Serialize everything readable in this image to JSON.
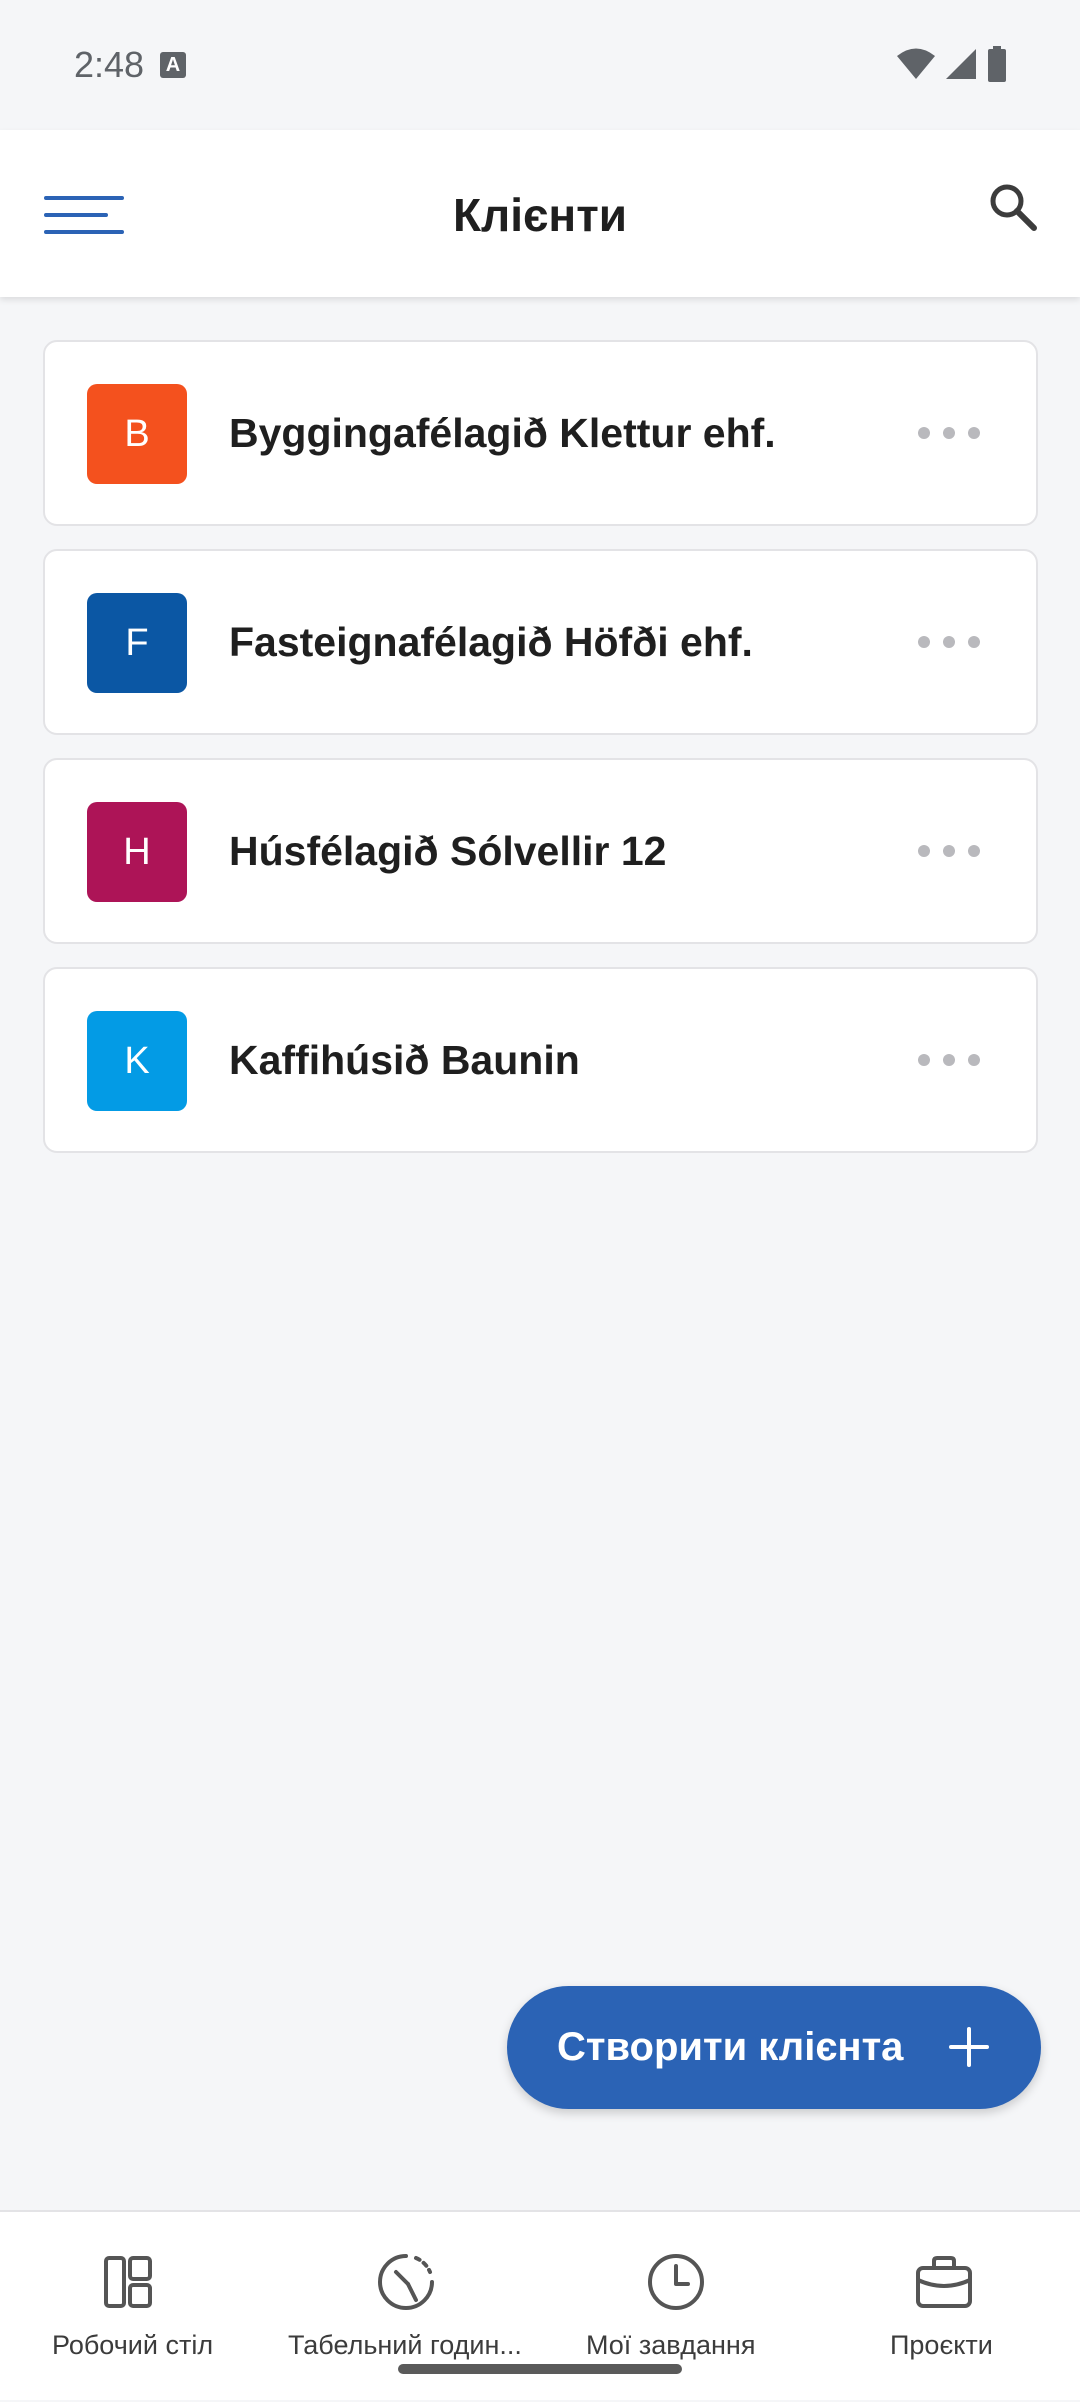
{
  "status_bar": {
    "time": "2:48",
    "notification_icon": "A"
  },
  "app_bar": {
    "title": "Клієнти",
    "menu_icon": "hamburger-menu-icon",
    "search_icon": "search-icon"
  },
  "clients": [
    {
      "initial": "B",
      "name": "Byggingafélagið Klettur ehf.",
      "color": "#f4511e"
    },
    {
      "initial": "F",
      "name": "Fasteignafélagið Höfði ehf.",
      "color": "#0b57a4"
    },
    {
      "initial": "H",
      "name": "Húsfélagið Sólvellir 12",
      "color": "#ad1457"
    },
    {
      "initial": "K",
      "name": "Kaffihúsið Baunin",
      "color": "#039be5"
    }
  ],
  "fab": {
    "label": "Створити клієнта"
  },
  "bottom_nav": [
    {
      "label": "Робочий стіл",
      "icon": "dashboard-icon"
    },
    {
      "label": "Табельний годин...",
      "icon": "timesheet-icon"
    },
    {
      "label": "Мої завдання",
      "icon": "clock-icon"
    },
    {
      "label": "Проєкти",
      "icon": "briefcase-icon"
    }
  ],
  "colors": {
    "accent": "#2b63b5",
    "background": "#f5f6f8"
  }
}
